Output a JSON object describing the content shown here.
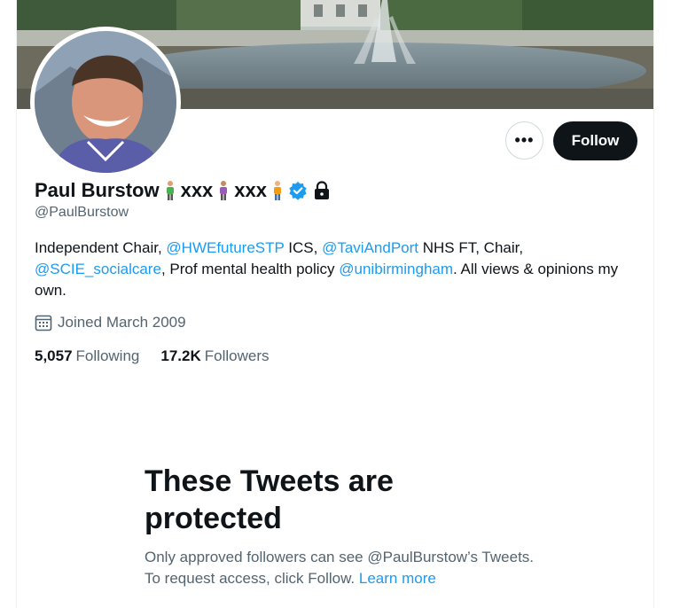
{
  "profile": {
    "display_name": "Paul Burstow",
    "name_extra_1": "xxx",
    "name_extra_2": "xxx",
    "handle": "@PaulBurstow",
    "bio": {
      "part1": "Independent Chair, ",
      "mention1": "@HWEfutureSTP",
      "part2": " ICS, ",
      "mention2": "@TaviAndPort",
      "part3": " NHS FT, Chair, ",
      "mention3": "@SCIE_socialcare",
      "part4": ", Prof mental health policy ",
      "mention4": "@unibirmingham",
      "part5": ". All views & opinions my own."
    },
    "joined": "Joined March 2009",
    "following_count": "5,057",
    "following_label": "Following",
    "followers_count": "17.2K",
    "followers_label": "Followers"
  },
  "actions": {
    "more_label": "•••",
    "follow_label": "Follow"
  },
  "protected": {
    "title": "These Tweets are protected",
    "text": "Only approved followers can see @PaulBurstow’s Tweets. To request access, click Follow. ",
    "learn_more": "Learn more"
  },
  "colors": {
    "link": "#1d9bf0",
    "text": "#0f1419",
    "secondary": "#536471",
    "verified": "#1d9bf0",
    "follow_bg": "#0f1419"
  }
}
